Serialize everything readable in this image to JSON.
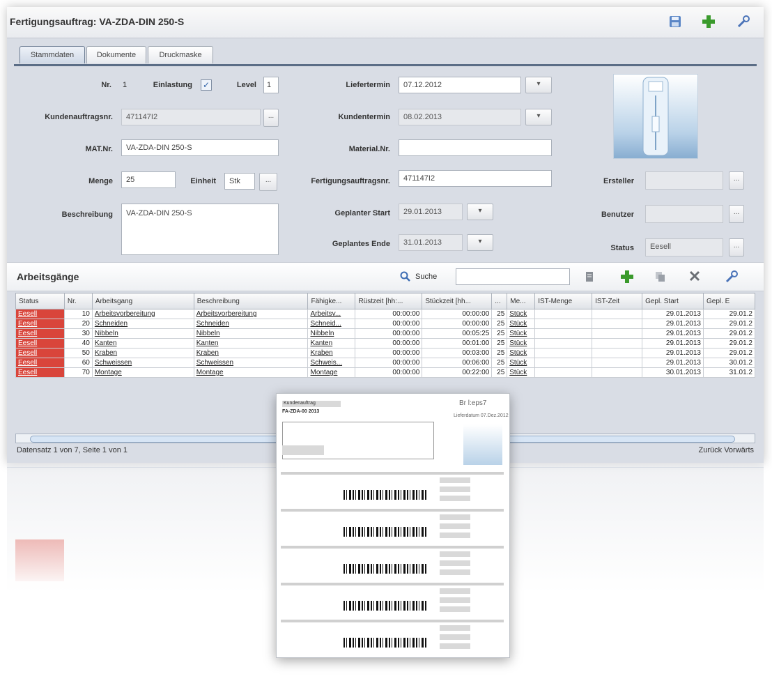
{
  "window": {
    "title": "Fertigungsauftrag: VA-ZDA-DIN 250-S"
  },
  "toolbar": {
    "icons": [
      "save-icon",
      "add-icon",
      "tools-icon"
    ]
  },
  "tabs": [
    {
      "label": "Stammdaten",
      "active": true
    },
    {
      "label": "Dokumente",
      "active": false
    },
    {
      "label": "Druckmaske",
      "active": false
    }
  ],
  "form": {
    "nr": {
      "label": "Nr.",
      "value": "1"
    },
    "einlastung": {
      "label": "Einlastung",
      "checked": true
    },
    "level": {
      "label": "Level",
      "value": "1"
    },
    "kundenauftragsnr": {
      "label": "Kundenauftragsnr.",
      "value": "471147I2"
    },
    "matnr": {
      "label": "MAT.Nr.",
      "value": "VA-ZDA-DIN 250-S"
    },
    "menge": {
      "label": "Menge",
      "value": "25"
    },
    "einheit": {
      "label": "Einheit",
      "value": "Stk"
    },
    "beschreibung": {
      "label": "Beschreibung",
      "value": "VA-ZDA-DIN 250-S"
    },
    "liefertermin": {
      "label": "Liefertermin",
      "value": "07.12.2012"
    },
    "kundentermin": {
      "label": "Kundentermin",
      "value": "08.02.2013"
    },
    "materialnr": {
      "label": "Material.Nr.",
      "value": ""
    },
    "fertigungsauftragsnr": {
      "label": "Fertigungsauftragsnr.",
      "value": "471147I2"
    },
    "geplanter_start": {
      "label": "Geplanter Start",
      "value": "29.01.2013"
    },
    "geplantes_ende": {
      "label": "Geplantes Ende",
      "value": "31.01.2013"
    },
    "ersteller": {
      "label": "Ersteller",
      "value": ""
    },
    "benutzer": {
      "label": "Benutzer",
      "value": ""
    },
    "status": {
      "label": "Status",
      "value": "Eesell"
    },
    "picker_glyph": "▾",
    "ellipsis": "..."
  },
  "section": {
    "title": "Arbeitsgänge",
    "search_label": "Suche",
    "search_value": ""
  },
  "table": {
    "columns": [
      "Status",
      "Nr.",
      "Arbeitsgang",
      "Beschreibung",
      "Fähigke...",
      "Rüstzeit [hh:...",
      "Stückzeit [hh...",
      "...",
      "Me...",
      "IST-Menge",
      "IST-Zeit",
      "Gepl. Start",
      "Gepl. E"
    ],
    "rows": [
      [
        "Eesell",
        "10",
        "Arbeitsvorbereitung",
        "Arbeitsvorbereitung",
        "Arbeitsv...",
        "00:00:00",
        "00:00:00",
        "25",
        "Stück",
        "",
        "",
        "29.01.2013",
        "29.01.2"
      ],
      [
        "Eesell",
        "20",
        "Schneiden",
        "Schneiden",
        "Schneid...",
        "00:00:00",
        "00:00:00",
        "25",
        "Stück",
        "",
        "",
        "29.01.2013",
        "29.01.2"
      ],
      [
        "Eesell",
        "30",
        "Nibbeln",
        "Nibbeln",
        "Nibbeln",
        "00:00:00",
        "00:05:25",
        "25",
        "Stück",
        "",
        "",
        "29.01.2013",
        "29.01.2"
      ],
      [
        "Eesell",
        "40",
        "Kanten",
        "Kanten",
        "Kanten",
        "00:00:00",
        "00:01:00",
        "25",
        "Stück",
        "",
        "",
        "29.01.2013",
        "29.01.2"
      ],
      [
        "Eesell",
        "50",
        "Kraben",
        "Kraben",
        "Kraben",
        "00:00:00",
        "00:03:00",
        "25",
        "Stück",
        "",
        "",
        "29.01.2013",
        "29.01.2"
      ],
      [
        "Eesell",
        "60",
        "Schweissen",
        "Schweissen",
        "Schweis...",
        "00:00:00",
        "00:06:00",
        "25",
        "Stück",
        "",
        "",
        "29.01.2013",
        "30.01.2"
      ],
      [
        "Eesell",
        "70",
        "Montage",
        "Montage",
        "Montage",
        "00:00:00",
        "00:22:00",
        "25",
        "Stück",
        "",
        "",
        "30.01.2013",
        "31.01.2"
      ]
    ]
  },
  "statusline": "Datensatz 1 von 7, Seite 1 von 1",
  "pager": "Zurück  Vorwärts",
  "preview": {
    "header_label": "Kundenauftrag",
    "header_value": "FA-ZDA-00 2013",
    "logo_text": "Br l:eps7",
    "date_text": "Lieferdatum 07.Dez.2012",
    "operation_blocks": 5
  }
}
